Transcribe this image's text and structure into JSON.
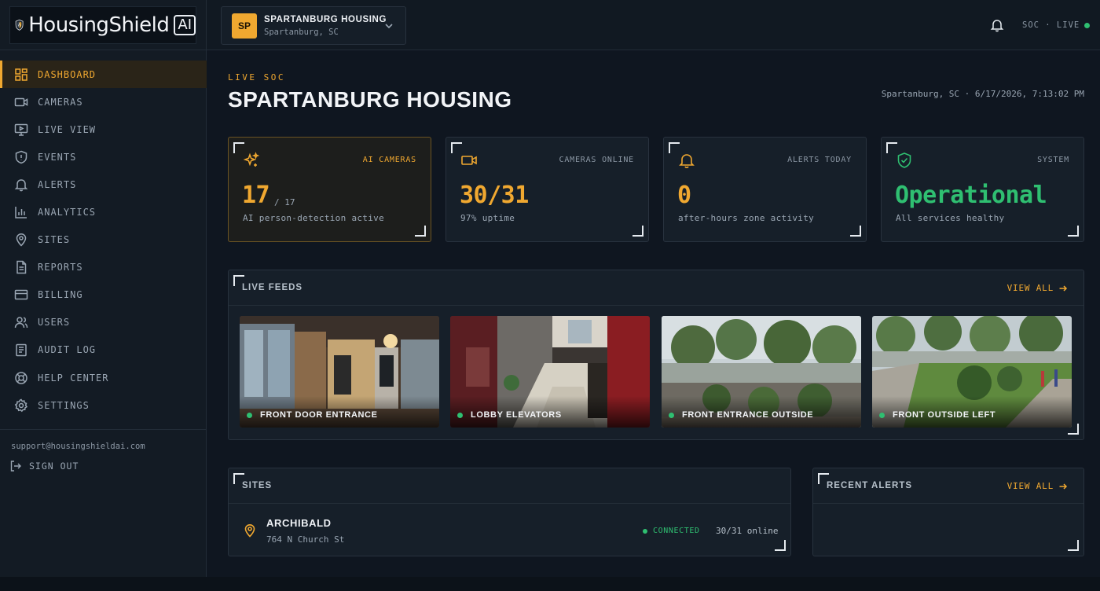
{
  "brand": {
    "name": "HousingShield",
    "badge": "AI"
  },
  "nav": {
    "items": [
      {
        "label": "DASHBOARD",
        "icon": "grid-icon",
        "active": true
      },
      {
        "label": "CAMERAS",
        "icon": "video-icon"
      },
      {
        "label": "LIVE VIEW",
        "icon": "monitor-icon"
      },
      {
        "label": "EVENTS",
        "icon": "shield-icon"
      },
      {
        "label": "ALERTS",
        "icon": "bell-icon"
      },
      {
        "label": "ANALYTICS",
        "icon": "bar-chart-icon"
      },
      {
        "label": "SITES",
        "icon": "map-pin-icon"
      },
      {
        "label": "REPORTS",
        "icon": "file-text-icon"
      },
      {
        "label": "BILLING",
        "icon": "credit-card-icon"
      },
      {
        "label": "USERS",
        "icon": "users-icon"
      },
      {
        "label": "AUDIT LOG",
        "icon": "clipboard-icon"
      },
      {
        "label": "HELP CENTER",
        "icon": "lifebuoy-icon"
      },
      {
        "label": "SETTINGS",
        "icon": "gear-icon"
      }
    ],
    "support_email": "support@housingshieldai.com",
    "sign_out": "SIGN OUT"
  },
  "topbar": {
    "site_badge": "SP",
    "site_name": "SPARTANBURG HOUSING",
    "site_location": "Spartanburg, SC",
    "status": "SOC · LIVE"
  },
  "header": {
    "kicker": "LIVE SOC",
    "title": "SPARTANBURG HOUSING",
    "datetime": "Spartanburg, SC · 6/17/2026, 7:13:02 PM"
  },
  "stats": [
    {
      "label": "AI CAMERAS",
      "value": "17",
      "of": "/ 17",
      "sub": "AI person-detection active",
      "icon": "sparkles-icon"
    },
    {
      "label": "CAMERAS ONLINE",
      "value": "30/31",
      "sub": "97% uptime",
      "icon": "video-icon"
    },
    {
      "label": "ALERTS TODAY",
      "value": "0",
      "sub": "after-hours zone activity",
      "icon": "bell-icon"
    },
    {
      "label": "SYSTEM",
      "value": "Operational",
      "sub": "All services healthy",
      "icon": "shield-check-icon"
    }
  ],
  "feeds": {
    "title": "LIVE FEEDS",
    "view_all": "VIEW ALL",
    "items": [
      {
        "label": "FRONT DOOR ENTRANCE"
      },
      {
        "label": "LOBBY ELEVATORS"
      },
      {
        "label": "FRONT ENTRANCE OUTSIDE"
      },
      {
        "label": "FRONT OUTSIDE LEFT"
      }
    ]
  },
  "sites": {
    "title": "SITES",
    "items": [
      {
        "name": "ARCHIBALD",
        "address": "764 N Church St",
        "status": "CONNECTED",
        "online": "30/31 online"
      }
    ]
  },
  "recent_alerts": {
    "title": "RECENT ALERTS",
    "view_all": "VIEW ALL"
  },
  "colors": {
    "accent": "#f0a830",
    "success": "#2fbf71",
    "bg": "#0f1620",
    "panel": "#161f29"
  }
}
